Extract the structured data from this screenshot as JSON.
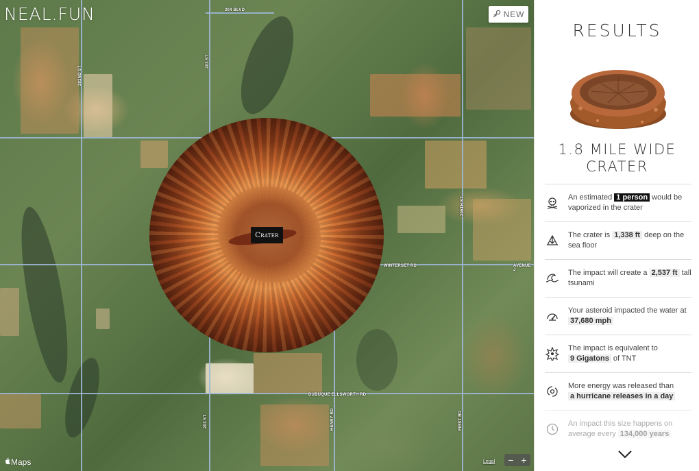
{
  "brand": {
    "logo_text": "NEAL.FUN"
  },
  "map": {
    "new_button_label": "NEW",
    "crater_label": "Crater",
    "maps_brand": "Maps",
    "legal_text": "Legal",
    "zoom_out": "−",
    "zoom_in": "+",
    "road_labels": {
      "r1": "204 BLVD",
      "r2": "202ND ST",
      "r3": "203 ST",
      "r4": "205TH ST",
      "r5": "WINTERSET RD",
      "r6": "AVENUE J",
      "r7": "DUBUQUE ELLSWORTH RD",
      "r8": "203 ST",
      "r9": "HENRY RD",
      "r10": "FIRST RD"
    }
  },
  "results": {
    "title": "RESULTS",
    "crater_width_line1": "1.8 MILE WIDE",
    "crater_width_line2": "CRATER",
    "stats": [
      {
        "icon": "skull-crossbones-icon",
        "pre": "An estimated ",
        "value": "1 person",
        "post": " would be vaporized in the crater"
      },
      {
        "icon": "depth-icon",
        "pre": "The crater is ",
        "value": "1,338 ft",
        "post": " deep on the sea floor"
      },
      {
        "icon": "wave-icon",
        "pre": "The impact will create a ",
        "value": "2,537 ft",
        "post": " tall tsunami"
      },
      {
        "icon": "speedometer-icon",
        "pre": "Your asteroid impacted the water at ",
        "value": "37,680 mph",
        "post": ""
      },
      {
        "icon": "explosion-icon",
        "pre": "The impact is equivalent to ",
        "value": "9 Gigatons",
        "post": " of TNT"
      },
      {
        "icon": "hurricane-icon",
        "pre": "More energy was released than ",
        "value": "a hurricane releases in a day",
        "post": ""
      },
      {
        "icon": "clock-icon",
        "pre": "An impact this size happens on average every ",
        "value": "134,000 years",
        "post": ""
      }
    ],
    "scroll_icon": "chevron-down-icon"
  }
}
